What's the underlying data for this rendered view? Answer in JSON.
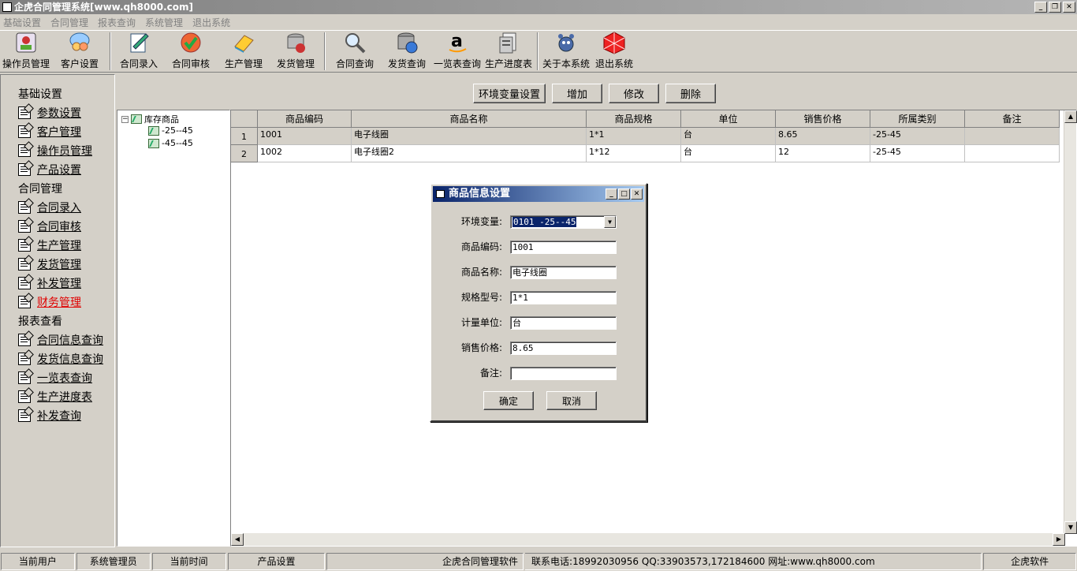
{
  "window": {
    "title": "企虎合同管理系统[www.qh8000.com]"
  },
  "menu": [
    "基础设置",
    "合同管理",
    "报表查询",
    "系统管理",
    "退出系统"
  ],
  "toolbar": [
    {
      "label": "操作员管理",
      "icon": "operator-icon"
    },
    {
      "label": "客户设置",
      "icon": "customer-icon"
    },
    {
      "label": "合同录入",
      "icon": "contract-entry-icon"
    },
    {
      "label": "合同审核",
      "icon": "audit-icon"
    },
    {
      "label": "生产管理",
      "icon": "production-icon"
    },
    {
      "label": "发货管理",
      "icon": "shipping-icon"
    },
    {
      "label": "合同查询",
      "icon": "search-icon"
    },
    {
      "label": "发货查询",
      "icon": "database-icon"
    },
    {
      "label": "一览表查询",
      "icon": "amazon-icon"
    },
    {
      "label": "生产进度表",
      "icon": "progress-icon"
    },
    {
      "label": "关于本系统",
      "icon": "about-icon"
    },
    {
      "label": "退出系统",
      "icon": "exit-icon"
    }
  ],
  "sidebar": {
    "groups": [
      "基础设置",
      "合同管理",
      "报表查看"
    ],
    "basic": [
      "参数设置",
      "客户管理",
      "操作员管理",
      "产品设置"
    ],
    "contract": [
      "合同录入",
      "合同审核",
      "生产管理",
      "发货管理",
      "补发管理",
      "财务管理"
    ],
    "report": [
      "合同信息查询",
      "发货信息查询",
      "一览表查询",
      "生产进度表",
      "补发查询"
    ]
  },
  "tree": {
    "root": "库存商品",
    "children": [
      "-25--45",
      "-45--45"
    ]
  },
  "actions": {
    "env": "环境变量设置",
    "add": "增加",
    "edit": "修改",
    "delete": "删除"
  },
  "table": {
    "headers": [
      "商品编码",
      "商品名称",
      "商品规格",
      "单位",
      "销售价格",
      "所属类别",
      "备注"
    ],
    "rows": [
      {
        "num": "1",
        "cells": [
          "1001",
          "电子线圈",
          "1*1",
          "台",
          "8.65",
          "-25-45",
          ""
        ]
      },
      {
        "num": "2",
        "cells": [
          "1002",
          "电子线圈2",
          "1*12",
          "台",
          "12",
          "-25-45",
          ""
        ]
      }
    ]
  },
  "dialog": {
    "title": "商品信息设置",
    "labels": {
      "env": "环境变量:",
      "code": "商品编码:",
      "name": "商品名称:",
      "spec": "规格型号:",
      "unit": "计量单位:",
      "price": "销售价格:",
      "note": "备注:"
    },
    "values": {
      "env": "0101 -25--45",
      "code": "1001",
      "name": "电子线圈",
      "spec": "1*1",
      "unit": "台",
      "price": "8.65",
      "note": ""
    },
    "ok": "确定",
    "cancel": "取消"
  },
  "status": {
    "user_label": "当前用户",
    "user": "系统管理员",
    "time_label": "当前时间",
    "module": "产品设置",
    "company": "企虎合同管理软件",
    "contact": "联系电话:18992030956 QQ:33903573,172184600 网址:www.qh8000.com",
    "brand": "企虎软件"
  }
}
